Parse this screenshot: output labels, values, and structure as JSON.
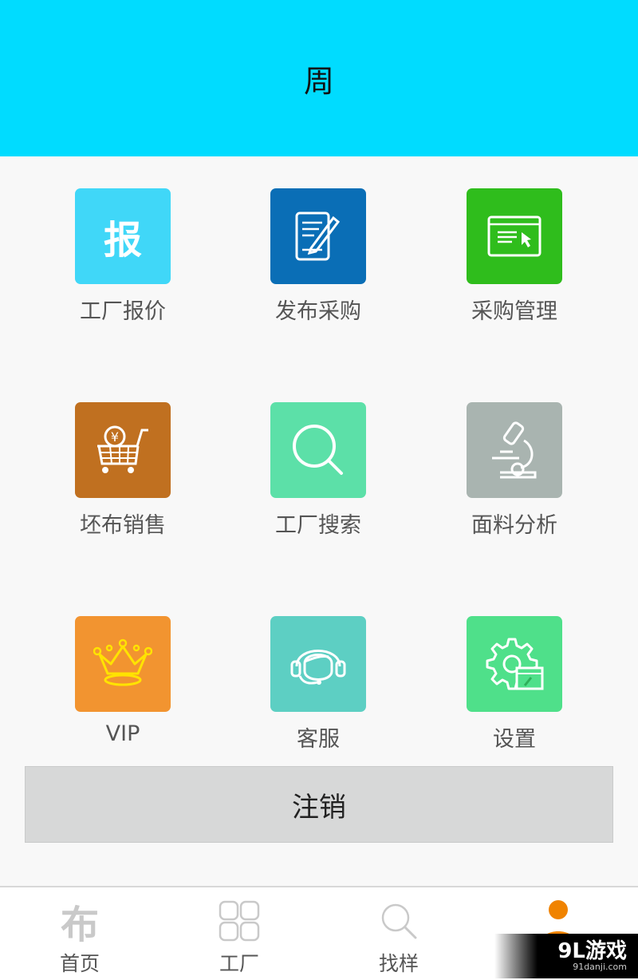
{
  "header": {
    "title": "周"
  },
  "tiles": [
    {
      "label": "工厂报价",
      "icon": "baojia-icon",
      "color": "#40d7f8",
      "glyph": "报"
    },
    {
      "label": "发布采购",
      "icon": "publish-purchase-icon",
      "color": "#0a6eb6"
    },
    {
      "label": "采购管理",
      "icon": "purchase-management-icon",
      "color": "#2fbd1c"
    },
    {
      "label": "坯布销售",
      "icon": "cart-icon",
      "color": "#c07020"
    },
    {
      "label": "工厂搜索",
      "icon": "search-icon",
      "color": "#5ce0a8"
    },
    {
      "label": "面料分析",
      "icon": "microscope-icon",
      "color": "#a9b4b0"
    },
    {
      "label": "VIP",
      "icon": "crown-icon",
      "color": "#f29430"
    },
    {
      "label": "客服",
      "icon": "headset-icon",
      "color": "#5dcfc3"
    },
    {
      "label": "设置",
      "icon": "gear-icon",
      "color": "#4fe08a"
    }
  ],
  "logout_label": "注销",
  "tabs": [
    {
      "label": "首页",
      "icon": "bu-logo-icon",
      "glyph": "布"
    },
    {
      "label": "工厂",
      "icon": "grid-icon"
    },
    {
      "label": "找样",
      "icon": "magnifier-icon"
    },
    {
      "label": "",
      "icon": "user-icon",
      "active": true,
      "color": "#f08300"
    }
  ],
  "watermark": {
    "main": "9L游戏",
    "sub": "91danji.com"
  }
}
